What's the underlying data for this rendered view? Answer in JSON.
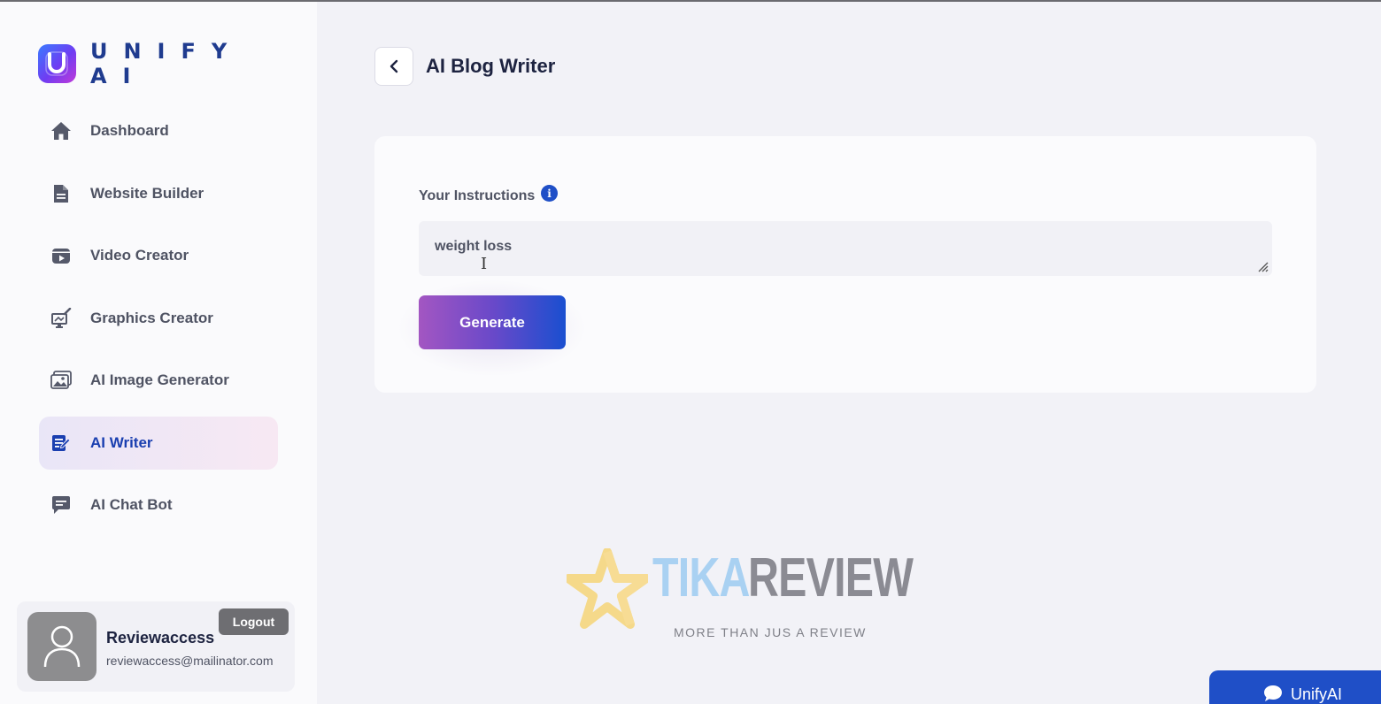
{
  "brand": {
    "name": "UNIFY AI"
  },
  "sidebar": {
    "items": [
      {
        "label": "Dashboard",
        "icon": "home-icon",
        "active": false
      },
      {
        "label": "Website Builder",
        "icon": "document-icon",
        "active": false
      },
      {
        "label": "Video Creator",
        "icon": "video-icon",
        "active": false
      },
      {
        "label": "Graphics Creator",
        "icon": "graphics-icon",
        "active": false
      },
      {
        "label": "AI Image Generator",
        "icon": "image-icon",
        "active": false
      },
      {
        "label": "AI Writer",
        "icon": "writer-icon",
        "active": true
      },
      {
        "label": "AI Chat Bot",
        "icon": "chat-icon",
        "active": false
      }
    ]
  },
  "user": {
    "name": "Reviewaccess",
    "email": "reviewaccess@mailinator.com",
    "logout_label": "Logout"
  },
  "page": {
    "title": "AI Blog Writer",
    "instructions_label": "Your Instructions",
    "instructions_value": "weight loss",
    "generate_label": "Generate"
  },
  "watermark": {
    "word1": "TIKA",
    "word2": "REVIEW",
    "tagline": "MORE THAN JUS A REVIEW"
  },
  "chat_widget": {
    "label": "UnifyAI"
  },
  "colors": {
    "accent": "#1f4fc7",
    "active_nav_text": "#1a3fb0",
    "generate_gradient_start": "#a356c2",
    "generate_gradient_end": "#1a4fd0"
  }
}
